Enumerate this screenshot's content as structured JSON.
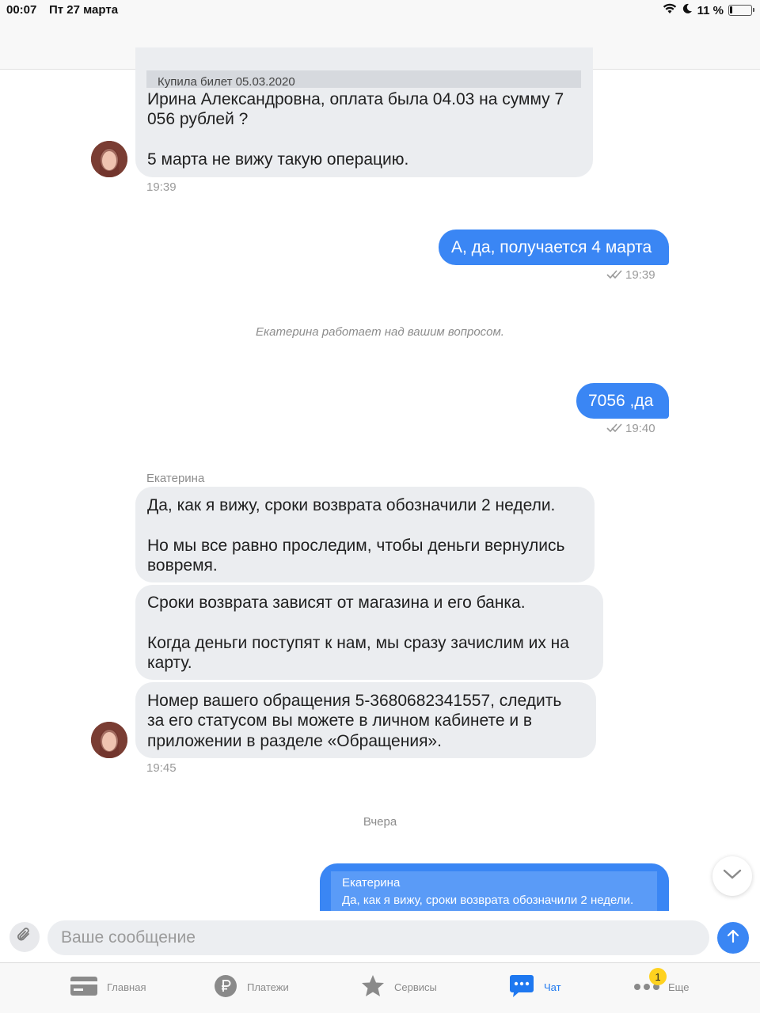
{
  "status_bar": {
    "time": "00:07",
    "date": "Пт 27 марта",
    "battery": "11 %"
  },
  "messages": {
    "m1": {
      "quote": "Купила билет 05.03.2020",
      "line1": "Ирина Александровна, оплата была 04.03 на сумму 7",
      "line2": "056 рублей ?",
      "line3": "5 марта не вижу такую операцию.",
      "time": "19:39"
    },
    "m2": {
      "text": "А, да, получается 4 марта",
      "time": "19:39"
    },
    "system": "Екатерина работает над вашим вопросом.",
    "m3": {
      "text": "7056 ,да",
      "time": "19:40"
    },
    "sender": "Екатерина",
    "m4": {
      "line1": "Да, как я вижу, сроки возврата обозначили 2 недели.",
      "line2": "Но мы все равно проследим, чтобы деньги вернулись",
      "line3": "вовремя."
    },
    "m5": {
      "line1": "Сроки возврата зависят от магазина и его банка.",
      "line2": "Когда деньги поступят к нам, мы сразу зачислим их на",
      "line3": "карту."
    },
    "m6": {
      "line1": "Номер вашего обращения 5-3680682341557, следить",
      "line2": "за его статусом вы можете в личном кабинете и в",
      "line3": "приложении в разделе «Обращения».",
      "time": "19:45"
    },
    "date_separator": "Вчера",
    "m7": {
      "quote_author": "Екатерина",
      "quote_text": "Да, как я вижу, сроки возврата обозначили 2 недели."
    }
  },
  "input": {
    "placeholder": "Ваше сообщение"
  },
  "tabs": [
    {
      "label": "Главная",
      "icon": "card-icon"
    },
    {
      "label": "Платежи",
      "icon": "ruble-icon"
    },
    {
      "label": "Сервисы",
      "icon": "star-icon"
    },
    {
      "label": "Чат",
      "icon": "chat-icon",
      "active": true
    },
    {
      "label": "Еще",
      "icon": "more-icon",
      "badge": "1"
    }
  ],
  "colors": {
    "accent": "#3a86f4",
    "incoming_bubble": "#ebedf0",
    "tab_active": "#1e78f0",
    "badge": "#ffd21f"
  }
}
